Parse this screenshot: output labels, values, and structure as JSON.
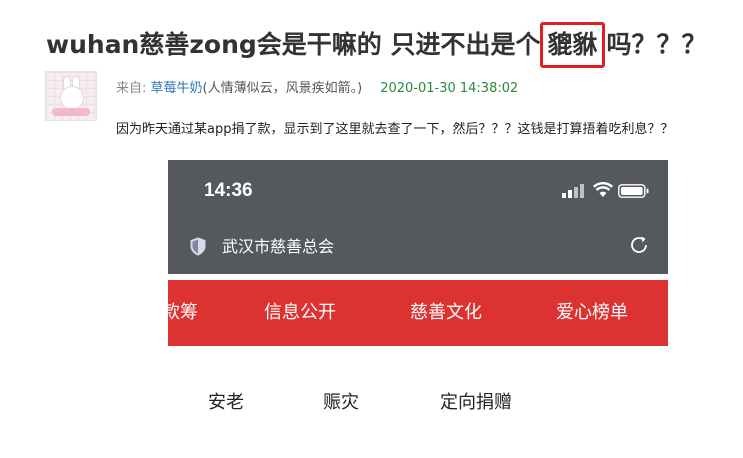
{
  "post": {
    "title_main": "wuhan慈善zong会是干嘛的 只进不出是个",
    "title_highlight": "貔貅",
    "title_tail": "吗？？？",
    "meta_from": "来自: ",
    "author": "草莓牛奶",
    "motto": "(人情薄似云，风景疾如箭。)",
    "date": "2020-01-30 14:38:02",
    "body": "因为昨天通过某app捐了款，显示到了这里就去查了一下，然后？？？这钱是打算捂着吃利息？？"
  },
  "phone": {
    "time": "14:36",
    "org_name": "武汉市慈善总会",
    "tabs": [
      "款筹",
      "信息公开",
      "慈善文化",
      "爱心榜单"
    ],
    "subnav": [
      "安老",
      "赈灾",
      "定向捐赠"
    ]
  },
  "colors": {
    "highlight_border": "#e02020",
    "status_bg": "#55585d",
    "nav_red": "#dc3232",
    "date_green": "#2a8a3e",
    "author_blue": "#2e78b5"
  },
  "icons": [
    "signal-icon",
    "wifi-icon",
    "battery-icon",
    "shield-icon",
    "reload-icon"
  ]
}
